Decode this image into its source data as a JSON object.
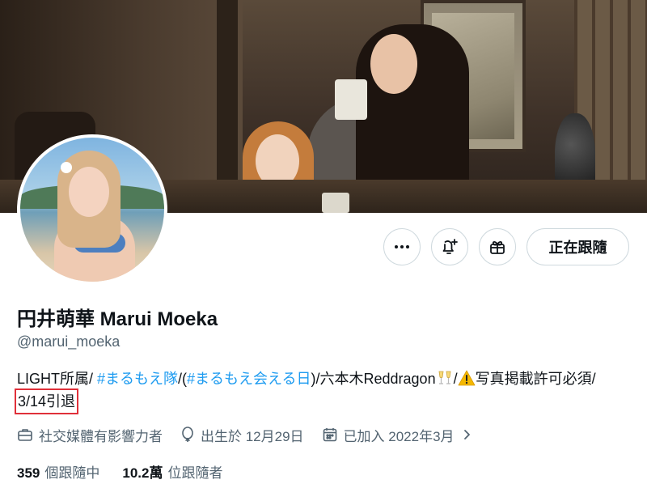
{
  "profile": {
    "display_name": "円井萌華 Marui Moeka",
    "handle": "@marui_moeka"
  },
  "bio": {
    "part1": "LIGHT所属/ ",
    "hashtag1": "#まるもえ隊",
    "part2": "/(",
    "hashtag2": "#まるもえ会える日",
    "part3": ")/六本木Reddragon",
    "part4": "/",
    "part5": "写真掲載許可必須/",
    "highlight": "3/14引退",
    "emoji1": "champagne-clink-icon",
    "emoji2": "warning-icon"
  },
  "actions": {
    "more_icon": "more-horizontal-icon",
    "notify_icon": "bell-plus-icon",
    "gift_icon": "gift-icon",
    "follow_label": "正在跟隨"
  },
  "meta": {
    "category": "社交媒體有影響力者",
    "birthday": "出生於 12月29日",
    "joined": "已加入 2022年3月"
  },
  "stats": {
    "following_count": "359",
    "following_label": "個跟隨中",
    "followers_count": "10.2萬",
    "followers_label": "位跟隨者"
  },
  "colors": {
    "link": "#1d9bf0",
    "text": "#0f1419",
    "secondary": "#536471",
    "highlight_box": "#e0303a"
  }
}
